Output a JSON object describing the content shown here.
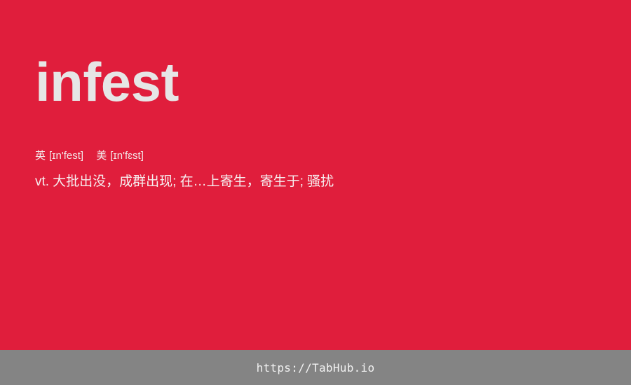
{
  "word": "infest",
  "phonetics": {
    "uk_label": "英",
    "uk": "[ɪn'fest]",
    "us_label": "美",
    "us": "[ɪn'fɛst]"
  },
  "definition": {
    "pos": "vt.",
    "text": "大批出没，成群出现; 在…上寄生，寄生于; 骚扰"
  },
  "footer": {
    "link": "https://TabHub.io"
  },
  "colors": {
    "background": "#e01e3c",
    "word_text": "#e6e6e6",
    "footer_background": "#848484",
    "footer_text": "#f2f2f2"
  }
}
